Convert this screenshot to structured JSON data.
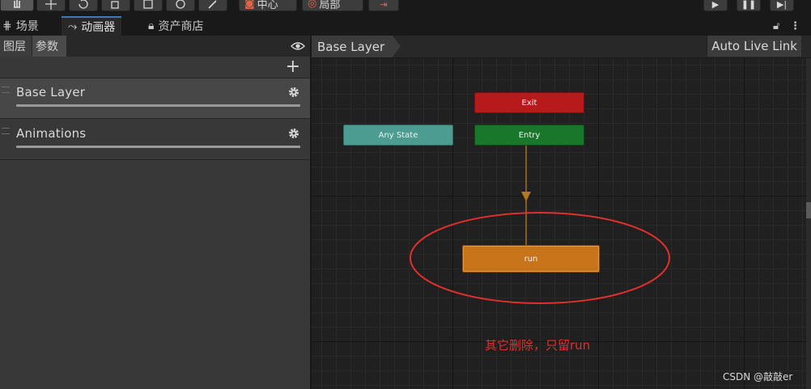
{
  "toolbar": {
    "pivot_center_label": "中心",
    "pivot_local_label": "局部"
  },
  "tabs": [
    {
      "label": "场景",
      "icon": "grid-icon"
    },
    {
      "label": "动画器",
      "icon": "animator-icon"
    },
    {
      "label": "资产商店",
      "icon": "bag-icon"
    }
  ],
  "left_panel": {
    "subtabs": [
      "图层",
      "参数"
    ],
    "layers": [
      {
        "name": "Base Layer",
        "weight": 1.0
      },
      {
        "name": "Animations",
        "weight": 1.0
      }
    ]
  },
  "graph": {
    "breadcrumb": "Base Layer",
    "live_link_label": "Auto Live Link",
    "nodes": {
      "exit": "Exit",
      "any_state": "Any State",
      "entry": "Entry",
      "run": "run"
    },
    "annotation": "其它删除，只留run",
    "watermark": "CSDN @敲敲er"
  },
  "colors": {
    "exit": "#b8191b",
    "entry": "#18772a",
    "any_state": "#4c9c92",
    "default_state": "#c8741a",
    "transition": "#8a5a10",
    "annotation": "#e2302c",
    "tab_accent": "#3a79bb"
  }
}
